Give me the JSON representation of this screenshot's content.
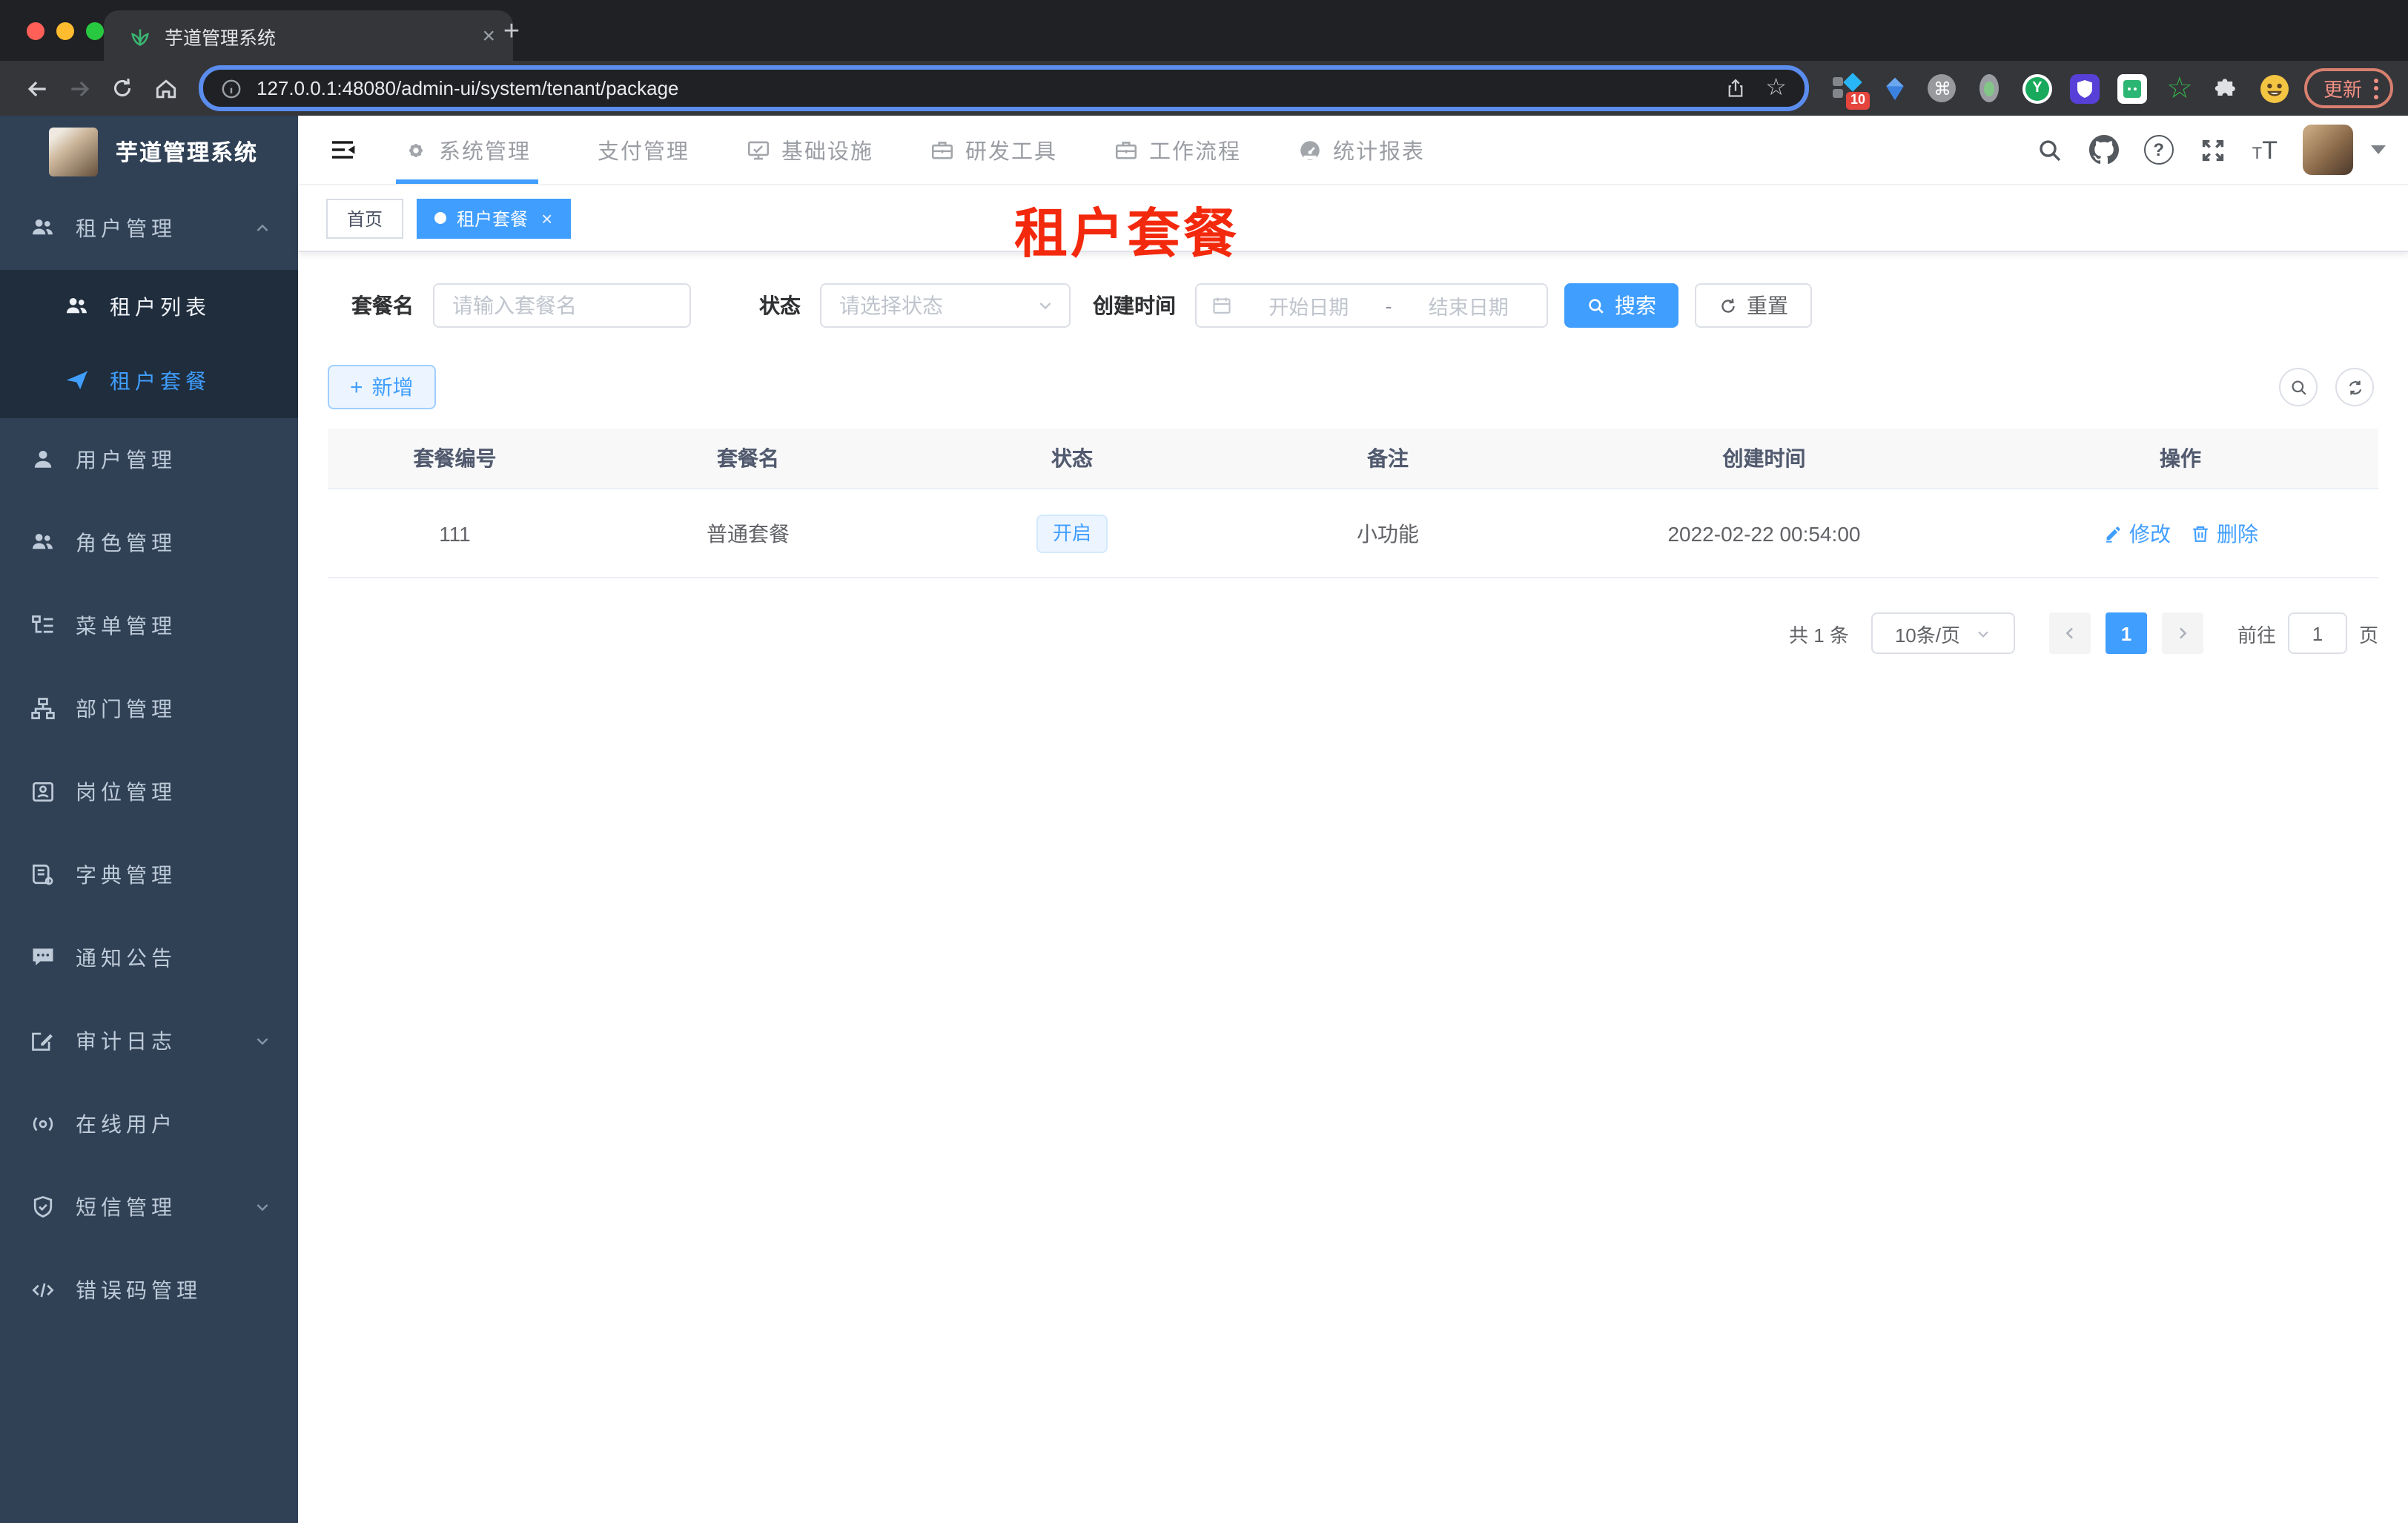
{
  "colors": {
    "accent": "#409eff",
    "sidebar_bg": "#304156",
    "submenu_bg": "#1f2d3d",
    "annotation_red": "#f3290d",
    "status_tag_bg": "#ecf5ff",
    "tab_active_bg": "#35363a",
    "frame_bg": "#202124",
    "update_chip": "#f29084"
  },
  "glyphs": {
    "close": "×",
    "new_tab": "+",
    "plus": "+",
    "star": "☆",
    "command": "⌘",
    "question": "?",
    "font_small": "T",
    "font_large": "T"
  },
  "browser": {
    "tab_title": "芋道管理系统",
    "url": "127.0.0.1:48080/admin-ui/system/tenant/package",
    "update_label": "更新",
    "extension_badge": "10",
    "extension_y": "Y"
  },
  "topnav": {
    "items": [
      {
        "label": "系统管理",
        "active": true
      },
      {
        "label": "支付管理",
        "active": false
      },
      {
        "label": "基础设施",
        "active": false
      },
      {
        "label": "研发工具",
        "active": false
      },
      {
        "label": "工作流程",
        "active": false
      },
      {
        "label": "统计报表",
        "active": false
      }
    ]
  },
  "sidebar": {
    "title": "芋道管理系统",
    "items": [
      {
        "label": "租户管理"
      },
      {
        "label": "租户列表"
      },
      {
        "label": "租户套餐"
      },
      {
        "label": "用户管理"
      },
      {
        "label": "角色管理"
      },
      {
        "label": "菜单管理"
      },
      {
        "label": "部门管理"
      },
      {
        "label": "岗位管理"
      },
      {
        "label": "字典管理"
      },
      {
        "label": "通知公告"
      },
      {
        "label": "审计日志"
      },
      {
        "label": "在线用户"
      },
      {
        "label": "短信管理"
      },
      {
        "label": "错误码管理"
      }
    ]
  },
  "tags": {
    "home": "首页",
    "active": "租户套餐"
  },
  "annotation": {
    "text": "租户套餐"
  },
  "filter": {
    "name_label": "套餐名",
    "name_placeholder": "请输入套餐名",
    "status_label": "状态",
    "status_placeholder": "请选择状态",
    "date_label": "创建时间",
    "date_start_placeholder": "开始日期",
    "date_separator": "-",
    "date_end_placeholder": "结束日期",
    "search_label": "搜索",
    "reset_label": "重置"
  },
  "toolbar": {
    "add_label": "新增"
  },
  "table": {
    "headers": [
      "套餐编号",
      "套餐名",
      "状态",
      "备注",
      "创建时间",
      "操作"
    ],
    "rows": [
      {
        "id": "111",
        "name": "普通套餐",
        "status": "开启",
        "remark": "小功能",
        "created_at": "2022-02-22 00:54:00",
        "edit_label": "修改",
        "delete_label": "删除"
      }
    ]
  },
  "pagination": {
    "total": "共 1 条",
    "page_size": "10条/页",
    "current_page": "1",
    "goto_label": "前往",
    "goto_value": "1",
    "page_unit": "页"
  }
}
